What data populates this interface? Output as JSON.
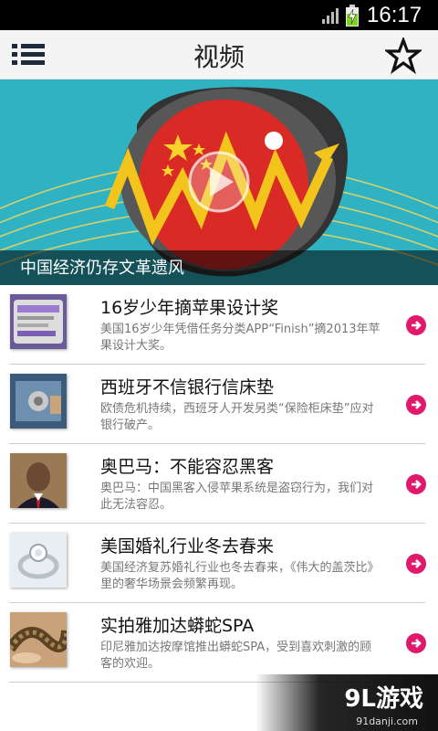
{
  "status_bar": {
    "time": "16:17",
    "signal_icon": "signal-icon",
    "battery_icon": "battery-charging-icon"
  },
  "header": {
    "title": "视频",
    "menu_icon": "list-menu-icon",
    "favorite_icon": "star-icon"
  },
  "banner": {
    "caption": "中国经济仍存文革遗风",
    "play_icon": "play-icon"
  },
  "news": [
    {
      "title": "16岁少年摘苹果设计奖",
      "desc": "美国16岁少年凭借任务分类APP“Finish”摘2013年苹果设计大奖。"
    },
    {
      "title": "西班牙不信银行信床垫",
      "desc": "欧债危机持续，西班牙人开发另类“保险柜床垫”应对银行破产。"
    },
    {
      "title": "奥巴马：不能容忍黑客",
      "desc": "奥巴马：中国黑客入侵苹果系统是盗窃行为，我们对此无法容忍。"
    },
    {
      "title": "美国婚礼行业冬去春来",
      "desc": "美国经济复苏婚礼行业也冬去春来，《伟大的盖茨比》里的奢华场景会频繁再现。"
    },
    {
      "title": "实拍雅加达蟒蛇SPA",
      "desc": "印尼雅加达按摩馆推出蟒蛇SPA，受到喜欢刺激的顾客的欢迎。"
    }
  ],
  "watermark": {
    "logo": "9L游戏",
    "url": "91danji.com"
  },
  "colors": {
    "accent": "#e0196d",
    "banner_bg": "#2fb3c3"
  }
}
